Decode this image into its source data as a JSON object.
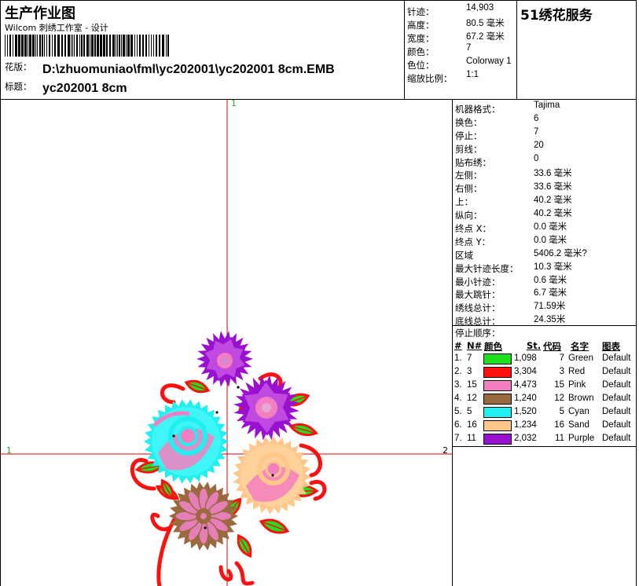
{
  "header": {
    "title": "生产作业图",
    "subtitle": "Wilcom 刺绣工作室 - 设计",
    "design_label": "花版：",
    "design_path": "D:\\zhuomuniao\\fml\\yc202001\\yc202001 8cm.EMB",
    "name_label": "标题：",
    "design_name": "yc202001 8cm",
    "brand": "51绣花服务"
  },
  "summary": [
    {
      "key": "针迹：",
      "value": "14,903"
    },
    {
      "key": "高度：",
      "value": "80.5 毫米"
    },
    {
      "key": "宽度：",
      "value": "67.2 毫米"
    },
    {
      "key": "颜色：",
      "value": "7"
    },
    {
      "key": "色位：",
      "value": "Colorway 1"
    },
    {
      "key": "缩放比例：",
      "value": "1:1"
    }
  ],
  "details": [
    {
      "key": "机器格式：",
      "value": "Tajima"
    },
    {
      "key": "换色：",
      "value": "6"
    },
    {
      "key": "停止：",
      "value": "7"
    },
    {
      "key": "剪线：",
      "value": "20"
    },
    {
      "key": "贴布绣：",
      "value": "0"
    },
    {
      "key": "左侧：",
      "value": "33.6 毫米"
    },
    {
      "key": "右侧：",
      "value": "33.6 毫米"
    },
    {
      "key": "上：",
      "value": "40.2 毫米"
    },
    {
      "key": "纵向：",
      "value": "40.2 毫米"
    },
    {
      "key": "终点 X：",
      "value": "0.0 毫米"
    },
    {
      "key": "终点 Y：",
      "value": "0.0 毫米"
    },
    {
      "key": "区域",
      "value": "5406.2 毫米?"
    },
    {
      "key": "最大针迹长度：",
      "value": "10.3 毫米"
    },
    {
      "key": "最小针迹：",
      "value": "0.6 毫米"
    },
    {
      "key": "最大跳针：",
      "value": "6.7 毫米"
    },
    {
      "key": "绣线总计：",
      "value": "71.59米"
    },
    {
      "key": "底线总计：",
      "value": "24.35米"
    }
  ],
  "stop_sequence": {
    "title": "停止顺序：",
    "columns": [
      "#",
      "N#",
      "颜色",
      "St.",
      "代码",
      "名字",
      "图表"
    ],
    "rows": [
      {
        "idx": "1.",
        "n": "7",
        "color": "#1ee11e",
        "stitches": "1,098",
        "code": "7",
        "name": "Green",
        "chart": "Default"
      },
      {
        "idx": "2.",
        "n": "3",
        "color": "#ff1010",
        "stitches": "3,304",
        "code": "3",
        "name": "Red",
        "chart": "Default"
      },
      {
        "idx": "3.",
        "n": "15",
        "color": "#f47fc0",
        "stitches": "4,473",
        "code": "15",
        "name": "Pink",
        "chart": "Default"
      },
      {
        "idx": "4.",
        "n": "12",
        "color": "#9a6a3e",
        "stitches": "1,240",
        "code": "12",
        "name": "Brown",
        "chart": "Default"
      },
      {
        "idx": "5.",
        "n": "5",
        "color": "#20f0f0",
        "stitches": "1,520",
        "code": "5",
        "name": "Cyan",
        "chart": "Default"
      },
      {
        "idx": "6.",
        "n": "16",
        "color": "#ffc88a",
        "stitches": "1,234",
        "code": "16",
        "name": "Sand",
        "chart": "Default"
      },
      {
        "idx": "7.",
        "n": "11",
        "color": "#9a10d0",
        "stitches": "2,032",
        "code": "11",
        "name": "Purple",
        "chart": "Default"
      }
    ]
  },
  "axis_labels": {
    "top": "1",
    "left": "1",
    "right": "2"
  },
  "colors": {
    "axis": "#e00000",
    "axis_label": "#22aa22"
  }
}
